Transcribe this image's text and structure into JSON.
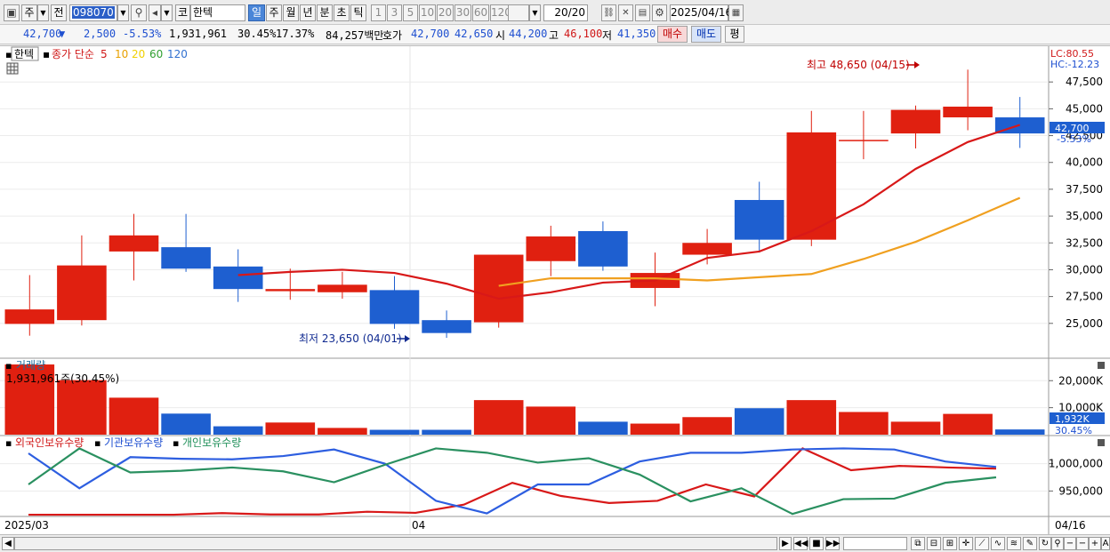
{
  "toolbar": {
    "period_label": "주",
    "prev_label": "전",
    "code": "098070",
    "code_label": "코",
    "stock_name": "한텍",
    "periods": [
      "일",
      "주",
      "월",
      "년",
      "분",
      "초",
      "틱"
    ],
    "active_period": "일",
    "intervals": [
      "1",
      "3",
      "5",
      "10",
      "20",
      "30",
      "60",
      "120"
    ],
    "count": "20/20",
    "date": "2025/04/16"
  },
  "quote": {
    "price": "42,700",
    "direction": "▼",
    "change": "2,500",
    "change_pct": "-5.53%",
    "volume": "1,931,961",
    "volume_pct": "30.45%",
    "turnover": "17.37%",
    "amount": "84,257백만",
    "ask_label": "호가",
    "ask": "42,700",
    "bid": "42,650",
    "open_label": "시",
    "open": "44,200",
    "high_label": "고",
    "high": "46,100",
    "low_label": "저",
    "low": "41,350",
    "buy_label": "매수",
    "sell_label": "매도",
    "avg_label": "평"
  },
  "legend": {
    "stock": "한텍",
    "ma_label": "종가 단순",
    "ma_periods": [
      "5",
      "10",
      "20",
      "60",
      "120"
    ],
    "ma_colors": [
      "#d01818",
      "#e8a000",
      "#f0d000",
      "#30a030",
      "#3070d0"
    ]
  },
  "price_panel": {
    "lc": "LC:80.55",
    "hc": "HC:-12.23",
    "max_label": "최고 48,650 (04/15)",
    "min_label": "최저 23,650 (04/01)",
    "current_price": "42,700",
    "current_pct": "-5.53%"
  },
  "volume_panel": {
    "title": "거래량",
    "note": "1,931,961주(30.45%)",
    "current": "1,932K",
    "current_pct": "30.45%"
  },
  "holdings_panel": {
    "foreign_label": "외국인보유수량",
    "inst_label": "기관보유수량",
    "indiv_label": "개인보유수량"
  },
  "x_axis": {
    "left": "2025/03",
    "mid": "04",
    "right": "04/16"
  },
  "chart_data": [
    {
      "type": "candlestick",
      "title": "",
      "ylim": [
        22000,
        50500
      ],
      "y_ticks": [
        25000,
        27500,
        30000,
        32500,
        35000,
        37500,
        40000,
        42500,
        45000,
        47500
      ],
      "candles": [
        {
          "o": 24950,
          "h": 29500,
          "l": 23850,
          "c": 26300
        },
        {
          "o": 25300,
          "h": 33200,
          "l": 24800,
          "c": 30400
        },
        {
          "o": 31700,
          "h": 35200,
          "l": 29000,
          "c": 33200
        },
        {
          "o": 32100,
          "h": 35200,
          "l": 29800,
          "c": 30100
        },
        {
          "o": 30300,
          "h": 31900,
          "l": 27000,
          "c": 28200
        },
        {
          "o": 28000,
          "h": 30100,
          "l": 27200,
          "c": 28200
        },
        {
          "o": 27900,
          "h": 29800,
          "l": 27300,
          "c": 28600
        },
        {
          "o": 28100,
          "h": 29400,
          "l": 24500,
          "c": 24950
        },
        {
          "o": 25300,
          "h": 26200,
          "l": 23650,
          "c": 24100
        },
        {
          "o": 25100,
          "h": 31400,
          "l": 24600,
          "c": 31400
        },
        {
          "o": 30800,
          "h": 34100,
          "l": 29400,
          "c": 33100
        },
        {
          "o": 33600,
          "h": 34500,
          "l": 29900,
          "c": 30300
        },
        {
          "o": 28300,
          "h": 31600,
          "l": 26600,
          "c": 29700
        },
        {
          "o": 31400,
          "h": 33800,
          "l": 30500,
          "c": 32500
        },
        {
          "o": 36500,
          "h": 38200,
          "l": 31600,
          "c": 32800
        },
        {
          "o": 32800,
          "h": 44800,
          "l": 32200,
          "c": 42800
        },
        {
          "o": 42100,
          "h": 44800,
          "l": 40300,
          "c": 42100
        },
        {
          "o": 42700,
          "h": 45300,
          "l": 41300,
          "c": 44900
        },
        {
          "o": 44200,
          "h": 48650,
          "l": 43000,
          "c": 45200
        },
        {
          "o": 44200,
          "h": 46100,
          "l": 41350,
          "c": 42700
        }
      ],
      "series": [
        {
          "name": "5",
          "values": [
            null,
            null,
            null,
            null,
            29500,
            29800,
            30000,
            29700,
            28700,
            27300,
            27900,
            28800,
            29000,
            31100,
            31700,
            33600,
            36100,
            39400,
            41900,
            43500
          ]
        },
        {
          "name": "10",
          "values": [
            null,
            null,
            null,
            null,
            null,
            null,
            null,
            null,
            null,
            28500,
            29200,
            29200,
            29200,
            29000,
            29300,
            29600,
            31000,
            32600,
            34600,
            36700
          ]
        }
      ]
    },
    {
      "type": "bar",
      "title": "거래량",
      "ylim": [
        0,
        27000
      ],
      "y_ticks": [
        10000,
        20000
      ],
      "values": [
        26000,
        20200,
        13700,
        7800,
        3100,
        4500,
        2500,
        1800,
        1800,
        12800,
        10400,
        4800,
        4100,
        6500,
        9800,
        12800,
        8400,
        4800,
        7700,
        1932
      ],
      "colors": [
        "red",
        "red",
        "red",
        "blue",
        "blue",
        "red",
        "red",
        "blue",
        "blue",
        "red",
        "red",
        "blue",
        "red",
        "red",
        "blue",
        "red",
        "red",
        "red",
        "red",
        "blue"
      ]
    },
    {
      "type": "line",
      "title": "",
      "ylim": [
        905000,
        1045000
      ],
      "y_ticks": [
        950000,
        1000000
      ],
      "series": [
        {
          "name": "외국인보유수량",
          "values": [
            906500,
            906500,
            906500,
            906500,
            909500,
            907000,
            907000,
            912000,
            910000,
            925000,
            965000,
            941000,
            928000,
            932000,
            962000,
            940000,
            1028000,
            988000,
            996000,
            993000,
            991000
          ]
        },
        {
          "name": "기관보유수량",
          "values": [
            1019000,
            955000,
            1012000,
            1009000,
            1008000,
            1014000,
            1026000,
            1000000,
            932000,
            909000,
            962000,
            962000,
            1004000,
            1020000,
            1020000,
            1026000,
            1028000,
            1026000,
            1004000,
            994000
          ]
        },
        {
          "name": "개인보유수량",
          "values": [
            962000,
            1028000,
            984000,
            987000,
            993000,
            986000,
            966000,
            998000,
            1028000,
            1020000,
            1002000,
            1010000,
            980000,
            931000,
            955000,
            908000,
            935000,
            936000,
            965000,
            975000
          ]
        }
      ]
    }
  ]
}
